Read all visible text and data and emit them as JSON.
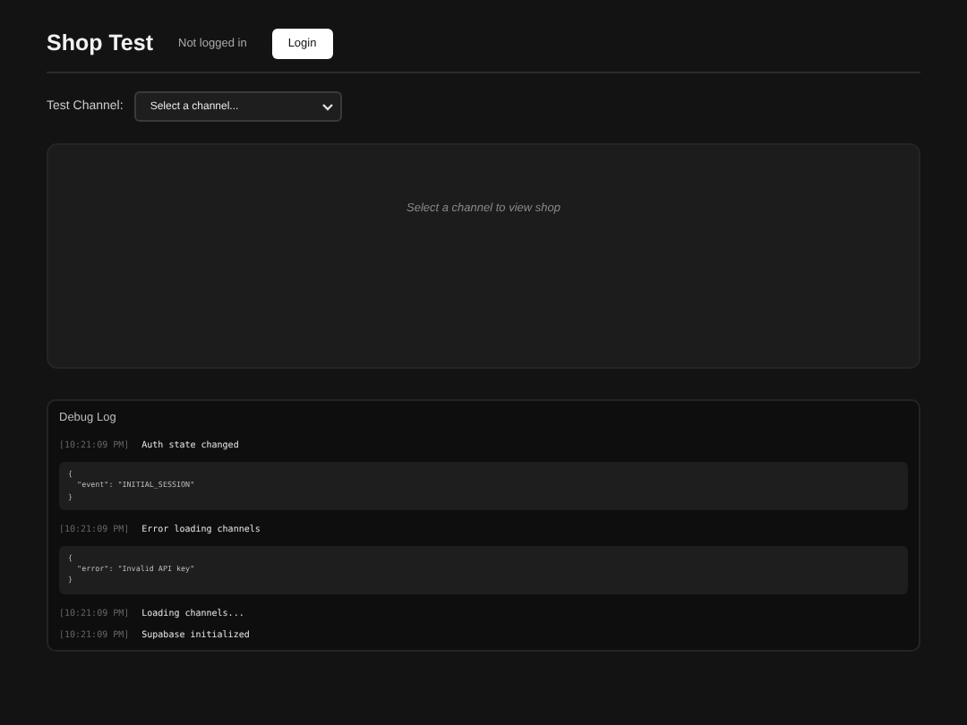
{
  "header": {
    "title": "Shop Test",
    "auth_status": "Not logged in",
    "login_button": "Login"
  },
  "channel_picker": {
    "label": "Test Channel:",
    "placeholder": "Select a channel..."
  },
  "shop_panel": {
    "message": "Select a channel to view shop"
  },
  "debug_log": {
    "title": "Debug Log",
    "entries": [
      {
        "time": "[10:21:09 PM]",
        "message": "Auth state changed",
        "details": "{\n  \"event\": \"INITIAL_SESSION\"\n}"
      },
      {
        "time": "[10:21:09 PM]",
        "message": "Error loading channels",
        "details": "{\n  \"error\": \"Invalid API key\"\n}"
      },
      {
        "time": "[10:21:09 PM]",
        "message": "Loading channels..."
      },
      {
        "time": "[10:21:09 PM]",
        "message": "Supabase initialized"
      }
    ]
  }
}
